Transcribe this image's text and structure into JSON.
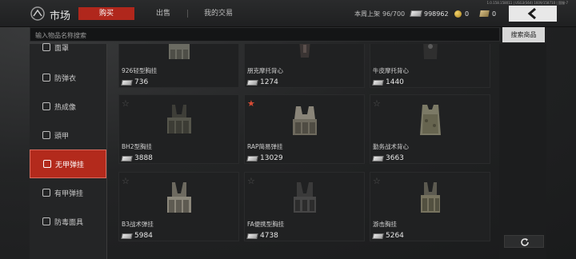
{
  "header": {
    "title": "市场",
    "tiny_info": "1.0.158.158011 | USG3(S64) 1609/158710 | 国服-7",
    "tabs": [
      {
        "label": "购买",
        "active": true
      },
      {
        "label": "出售",
        "active": false
      },
      {
        "label": "我的交易",
        "active": false
      }
    ],
    "weekly_label": "本周上架",
    "weekly_value": "96/700",
    "money": "998962",
    "coin": "0",
    "ticket": "0"
  },
  "search": {
    "placeholder": "输入物品名称搜索",
    "button": "搜索商品"
  },
  "sidebar": {
    "items": [
      {
        "label": "面罩",
        "icon": "mask-icon",
        "active": false
      },
      {
        "label": "防弹衣",
        "icon": "armor-icon",
        "active": false
      },
      {
        "label": "热成像",
        "icon": "thermal-icon",
        "active": false
      },
      {
        "label": "頭甲",
        "icon": "helmet-icon",
        "active": false
      },
      {
        "label": "无甲弹挂",
        "icon": "rig-icon",
        "active": true
      },
      {
        "label": "有甲弹挂",
        "icon": "armored-rig-icon",
        "active": false
      },
      {
        "label": "防毒面具",
        "icon": "gasmask-icon",
        "active": false
      }
    ]
  },
  "items": [
    {
      "name": "926轻型胸挂",
      "price": "736",
      "fav": false,
      "show_star": false
    },
    {
      "name": "朋克摩托背心",
      "price": "1274",
      "fav": false,
      "show_star": false
    },
    {
      "name": "牛皮摩托背心",
      "price": "1440",
      "fav": false,
      "show_star": false
    },
    {
      "name": "BH2型胸挂",
      "price": "3888",
      "fav": false,
      "show_star": true
    },
    {
      "name": "RAP简易弹挂",
      "price": "13029",
      "fav": true,
      "show_star": true
    },
    {
      "name": "勤务战术背心",
      "price": "3663",
      "fav": false,
      "show_star": true
    },
    {
      "name": "B3战术弹挂",
      "price": "5984",
      "fav": false,
      "show_star": true
    },
    {
      "name": "FA便携型胸挂",
      "price": "4738",
      "fav": false,
      "show_star": true
    },
    {
      "name": "游击胸挂",
      "price": "5264",
      "fav": false,
      "show_star": true
    }
  ],
  "colors": {
    "accent": "#b0271c",
    "favorite": "#d94c35"
  }
}
